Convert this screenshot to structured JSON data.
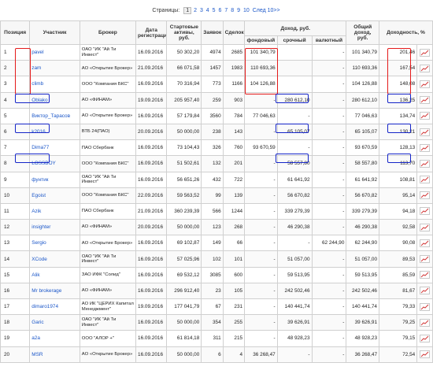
{
  "pager": {
    "label": "Страницы:",
    "pages": [
      "1",
      "2",
      "3",
      "4",
      "5",
      "6",
      "7",
      "8",
      "9",
      "10"
    ],
    "current": "1",
    "next": "След 10>>"
  },
  "headers": {
    "position": "Позиция",
    "participant": "Участник",
    "broker": "Брокер",
    "reg_date": "Дата регистрации",
    "start_assets": "Стартовые активы, руб.",
    "requests": "Заявок",
    "deals": "Сделок",
    "income_group": "Доход, руб.",
    "income_stock": "фондовый",
    "income_futures": "срочный",
    "income_currency": "валютный",
    "total_income": "Общий доход, руб.",
    "yield": "Доходность, %"
  },
  "rows": [
    {
      "pos": "1",
      "name": "pavel",
      "broker": "ОАО \"ИК \"Ай Ти Инвест\"",
      "date": "16.09.2016",
      "start": "50 302,20",
      "req": "4974",
      "deals": "2685",
      "stock": "101 340,79",
      "fut": "",
      "cur": "-",
      "total": "101 340,79",
      "yield": "201,46"
    },
    {
      "pos": "2",
      "name": "zam",
      "broker": "АО «Открытие Брокер»",
      "date": "21.09.2016",
      "start": "66 071,58",
      "req": "1457",
      "deals": "1983",
      "stock": "110 693,36",
      "fut": "",
      "cur": "-",
      "total": "110 693,36",
      "yield": "167,54"
    },
    {
      "pos": "3",
      "name": "climb",
      "broker": "ООО \"Компания БКС\"",
      "date": "16.09.2016",
      "start": "70 316,94",
      "req": "773",
      "deals": "1166",
      "stock": "104 126,88",
      "fut": "",
      "cur": "-",
      "total": "104 126,88",
      "yield": "148,08"
    },
    {
      "pos": "4",
      "name": "Oblako",
      "broker": "АО «ФИНАМ»",
      "date": "19.09.2016",
      "start": "205 957,40",
      "req": "259",
      "deals": "903",
      "stock": "-",
      "fut": "280 612,10",
      "cur": "-",
      "total": "280 612,10",
      "yield": "136,25"
    },
    {
      "pos": "5",
      "name": "Виктор_Тарасов",
      "broker": "АО «Открытие Брокер»",
      "date": "16.09.2016",
      "start": "57 179,84",
      "req": "3560",
      "deals": "784",
      "stock": "77 046,63",
      "fut": "-",
      "cur": "-",
      "total": "77 046,63",
      "yield": "134,74"
    },
    {
      "pos": "6",
      "name": "k2016",
      "broker": "ВТБ 24(ПАО)",
      "date": "20.09.2016",
      "start": "50 000,00",
      "req": "238",
      "deals": "143",
      "stock": "-",
      "fut": "65 105,07",
      "cur": "-",
      "total": "65 105,07",
      "yield": "130,21"
    },
    {
      "pos": "7",
      "name": "Dima77",
      "broker": "ПАО Сбербанк",
      "date": "16.09.2016",
      "start": "73 104,43",
      "req": "326",
      "deals": "760",
      "stock": "93 670,59",
      "fut": "-",
      "cur": "-",
      "total": "93 670,59",
      "yield": "128,13"
    },
    {
      "pos": "8",
      "name": "LOSSBOY",
      "broker": "ООО \"Компания БКС\"",
      "date": "16.09.2016",
      "start": "51 502,61",
      "req": "132",
      "deals": "201",
      "stock": "-",
      "fut": "58 557,80",
      "cur": "-",
      "total": "58 557,80",
      "yield": "113,70"
    },
    {
      "pos": "9",
      "name": "фунтик",
      "broker": "ОАО \"ИК \"Ай Ти Инвест\"",
      "date": "16.09.2016",
      "start": "56 651,26",
      "req": "432",
      "deals": "722",
      "stock": "-",
      "fut": "61 641,92",
      "cur": "-",
      "total": "61 641,92",
      "yield": "108,81"
    },
    {
      "pos": "10",
      "name": "Egoist",
      "broker": "ООО \"Компания БКС\"",
      "date": "22.09.2016",
      "start": "59 563,52",
      "req": "99",
      "deals": "139",
      "stock": "-",
      "fut": "56 670,82",
      "cur": "-",
      "total": "56 670,82",
      "yield": "95,14"
    },
    {
      "pos": "11",
      "name": "Azik",
      "broker": "ПАО Сбербанк",
      "date": "21.09.2016",
      "start": "360 239,39",
      "req": "566",
      "deals": "1244",
      "stock": "-",
      "fut": "339 279,39",
      "cur": "-",
      "total": "339 279,39",
      "yield": "94,18"
    },
    {
      "pos": "12",
      "name": "insighter",
      "broker": "АО «ФИНАМ»",
      "date": "20.09.2016",
      "start": "50 000,00",
      "req": "123",
      "deals": "268",
      "stock": "-",
      "fut": "46 290,38",
      "cur": "-",
      "total": "46 290,38",
      "yield": "92,58"
    },
    {
      "pos": "13",
      "name": "Sergio",
      "broker": "АО «Открытие Брокер»",
      "date": "16.09.2016",
      "start": "69 102,87",
      "req": "149",
      "deals": "66",
      "stock": "-",
      "fut": "-",
      "cur": "62 244,90",
      "total": "62 244,90",
      "yield": "90,08"
    },
    {
      "pos": "14",
      "name": "XCode",
      "broker": "ОАО \"ИК \"Ай Ти Инвест\"",
      "date": "16.09.2016",
      "start": "57 025,96",
      "req": "102",
      "deals": "101",
      "stock": "-",
      "fut": "51 057,00",
      "cur": "-",
      "total": "51 057,00",
      "yield": "89,53"
    },
    {
      "pos": "15",
      "name": "Alik",
      "broker": "ЗАО ИФК \"Солид\"",
      "date": "16.09.2016",
      "start": "69 532,12",
      "req": "3085",
      "deals": "600",
      "stock": "-",
      "fut": "59 513,95",
      "cur": "-",
      "total": "59 513,95",
      "yield": "85,59"
    },
    {
      "pos": "16",
      "name": "Mr brokerage",
      "broker": "АО «ФИНАМ»",
      "date": "16.09.2016",
      "start": "296 912,40",
      "req": "23",
      "deals": "105",
      "stock": "-",
      "fut": "242 502,46",
      "cur": "-",
      "total": "242 502,46",
      "yield": "81,67"
    },
    {
      "pos": "17",
      "name": "dimaro1974",
      "broker": "АО ИК \"ЦЕРИХ Капитал Менеджмент\"",
      "date": "19.09.2016",
      "start": "177 041,79",
      "req": "67",
      "deals": "231",
      "stock": "-",
      "fut": "140 441,74",
      "cur": "-",
      "total": "140 441,74",
      "yield": "79,33"
    },
    {
      "pos": "18",
      "name": "Garic",
      "broker": "ОАО \"ИК \"Ай Ти Инвест\"",
      "date": "16.09.2016",
      "start": "50 000,00",
      "req": "354",
      "deals": "255",
      "stock": "-",
      "fut": "39 626,91",
      "cur": "-",
      "total": "39 626,91",
      "yield": "79,25"
    },
    {
      "pos": "19",
      "name": "a2a",
      "broker": "ООО \"АЛОР +\"",
      "date": "16.09.2016",
      "start": "61 814,18",
      "req": "311",
      "deals": "215",
      "stock": "-",
      "fut": "48 928,23",
      "cur": "-",
      "total": "48 928,23",
      "yield": "79,15"
    },
    {
      "pos": "20",
      "name": "MSR",
      "broker": "АО «Открытие Брокер»",
      "date": "16.09.2016",
      "start": "50 000,00",
      "req": "6",
      "deals": "4",
      "stock": "36 268,47",
      "fut": "-",
      "cur": "-",
      "total": "36 268,47",
      "yield": "72,54"
    }
  ],
  "colors": {
    "link": "#1a56c8",
    "highlight_red": "#e41a1a",
    "highlight_blue": "#1424c8",
    "border": "#d0d0d0"
  },
  "row_icon": "chart-icon"
}
